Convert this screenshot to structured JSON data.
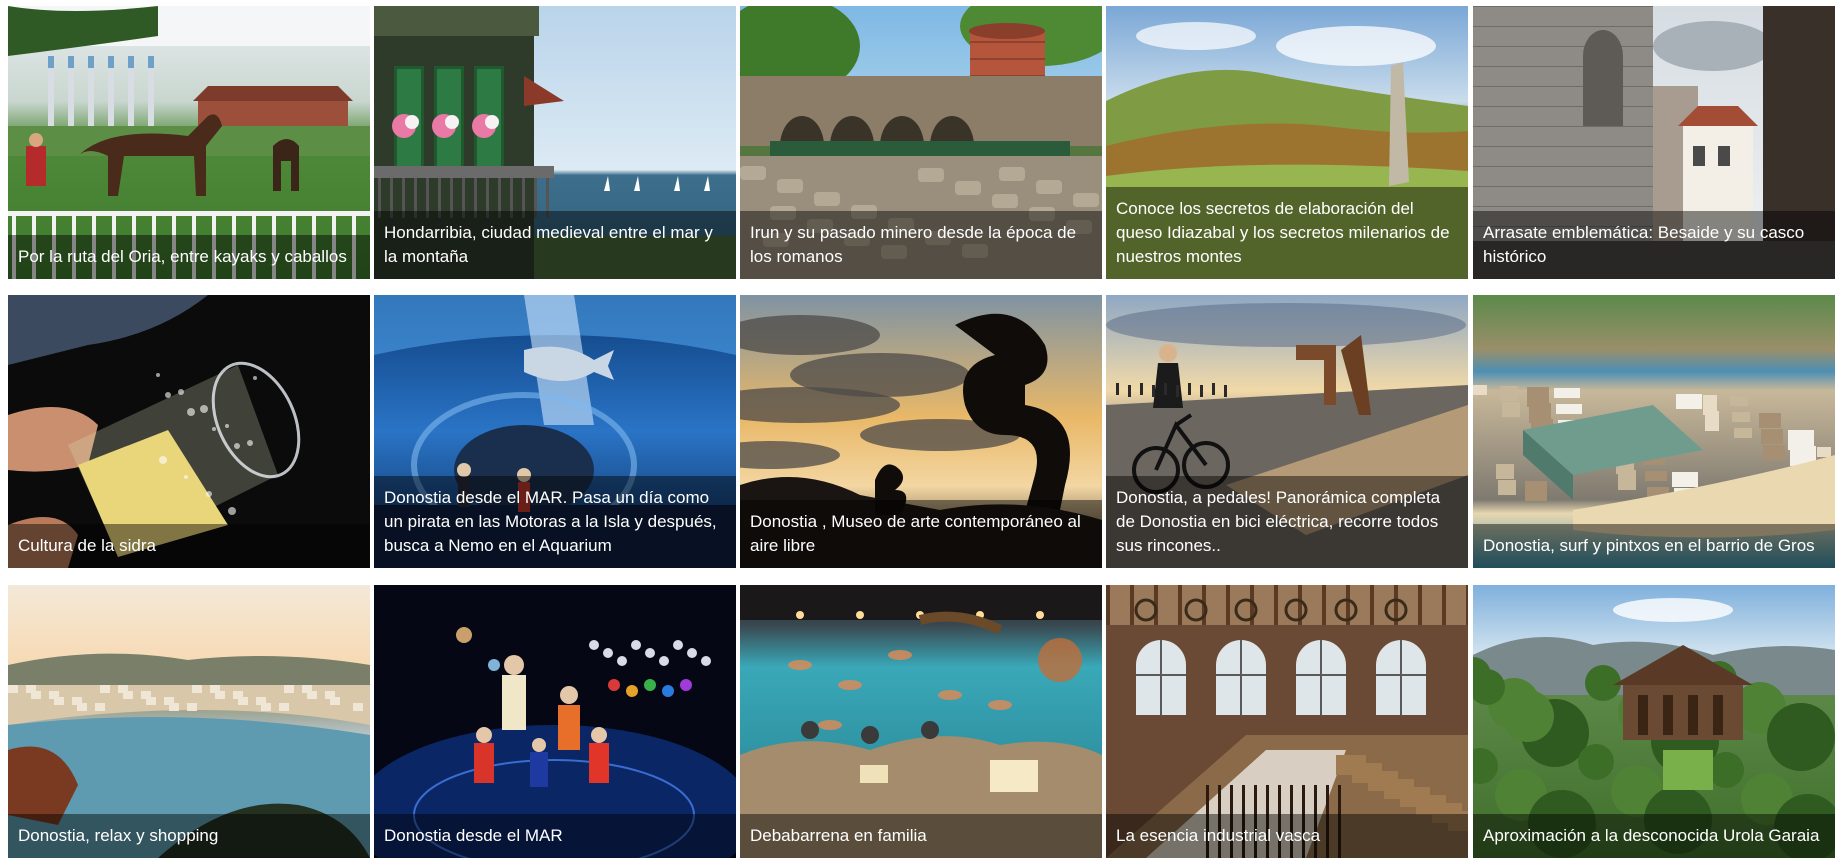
{
  "cards": [
    {
      "title": "Por la ruta del Oria, entre kayaks y caballos",
      "scene": "horse-paddock"
    },
    {
      "title": "Hondarribia, ciudad medieval entre el mar y la montaña",
      "scene": "balcony-sea"
    },
    {
      "title": "Irun y su pasado minero desde la época de los romanos",
      "scene": "mine-kiln"
    },
    {
      "title": "Conoce los secretos de elaboración del queso Idiazabal y los secretos milenarios de nuestros montes",
      "scene": "green-hills-menhir"
    },
    {
      "title": "Arrasate emblemática: Besaide y su casco histórico",
      "scene": "stone-church"
    },
    {
      "title": "Cultura de la sidra",
      "scene": "cider-glass"
    },
    {
      "title": "Donostia desde el MAR. Pasa un día como un pirata en las Motoras a la Isla y después, busca a Nemo en el Aquarium",
      "scene": "aquarium-tunnel"
    },
    {
      "title": "Donostia , Museo de arte contemporáneo al aire libre",
      "scene": "sunset-sculpture"
    },
    {
      "title": "Donostia, a pedales! Panorámica completa de Donostia en bici eléctrica, recorre todos sus rincones..",
      "scene": "cyclist-promenade"
    },
    {
      "title": "Donostia, surf y pintxos en el barrio de Gros",
      "scene": "aerial-city-beach"
    },
    {
      "title": "Donostia, relax y shopping",
      "scene": "bay-view"
    },
    {
      "title": "Donostia desde el MAR",
      "scene": "planetarium-kids"
    },
    {
      "title": "Debabarrena en familia",
      "scene": "fossil-museum"
    },
    {
      "title": "La esencia industrial vasca",
      "scene": "factory-interior"
    },
    {
      "title": "Aproximación a la desconocida Urola Garaia",
      "scene": "farmhouse-valley"
    }
  ]
}
